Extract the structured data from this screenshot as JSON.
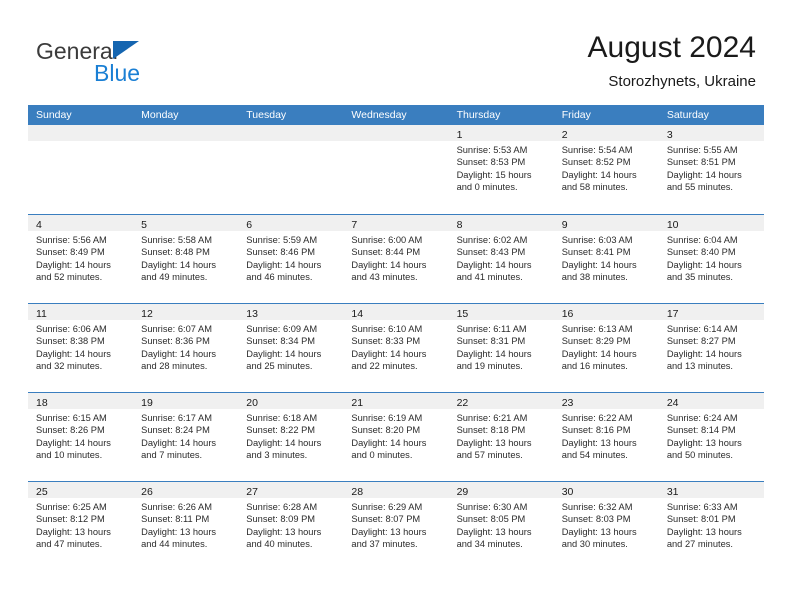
{
  "brand": {
    "name_dark": "General",
    "name_blue": "Blue",
    "triangle_icon": "triangle-icon",
    "accent_color": "#1a7fd4",
    "triangle_color": "#1565b0"
  },
  "header": {
    "title": "August 2024",
    "subtitle": "Storozhynets, Ukraine"
  },
  "colors": {
    "header_row_bg": "#3a7ebf",
    "day_band_bg": "#f0f0f0",
    "row_divider": "#3a7ebf",
    "text": "#1a1a1a"
  },
  "weekdays": [
    "Sunday",
    "Monday",
    "Tuesday",
    "Wednesday",
    "Thursday",
    "Friday",
    "Saturday"
  ],
  "weeks": [
    [
      {
        "day": "",
        "empty": true
      },
      {
        "day": "",
        "empty": true
      },
      {
        "day": "",
        "empty": true
      },
      {
        "day": "",
        "empty": true
      },
      {
        "day": "1",
        "sunrise": "Sunrise: 5:53 AM",
        "sunset": "Sunset: 8:53 PM",
        "daylight_1": "Daylight: 15 hours",
        "daylight_2": "and 0 minutes."
      },
      {
        "day": "2",
        "sunrise": "Sunrise: 5:54 AM",
        "sunset": "Sunset: 8:52 PM",
        "daylight_1": "Daylight: 14 hours",
        "daylight_2": "and 58 minutes."
      },
      {
        "day": "3",
        "sunrise": "Sunrise: 5:55 AM",
        "sunset": "Sunset: 8:51 PM",
        "daylight_1": "Daylight: 14 hours",
        "daylight_2": "and 55 minutes."
      }
    ],
    [
      {
        "day": "4",
        "sunrise": "Sunrise: 5:56 AM",
        "sunset": "Sunset: 8:49 PM",
        "daylight_1": "Daylight: 14 hours",
        "daylight_2": "and 52 minutes."
      },
      {
        "day": "5",
        "sunrise": "Sunrise: 5:58 AM",
        "sunset": "Sunset: 8:48 PM",
        "daylight_1": "Daylight: 14 hours",
        "daylight_2": "and 49 minutes."
      },
      {
        "day": "6",
        "sunrise": "Sunrise: 5:59 AM",
        "sunset": "Sunset: 8:46 PM",
        "daylight_1": "Daylight: 14 hours",
        "daylight_2": "and 46 minutes."
      },
      {
        "day": "7",
        "sunrise": "Sunrise: 6:00 AM",
        "sunset": "Sunset: 8:44 PM",
        "daylight_1": "Daylight: 14 hours",
        "daylight_2": "and 43 minutes."
      },
      {
        "day": "8",
        "sunrise": "Sunrise: 6:02 AM",
        "sunset": "Sunset: 8:43 PM",
        "daylight_1": "Daylight: 14 hours",
        "daylight_2": "and 41 minutes."
      },
      {
        "day": "9",
        "sunrise": "Sunrise: 6:03 AM",
        "sunset": "Sunset: 8:41 PM",
        "daylight_1": "Daylight: 14 hours",
        "daylight_2": "and 38 minutes."
      },
      {
        "day": "10",
        "sunrise": "Sunrise: 6:04 AM",
        "sunset": "Sunset: 8:40 PM",
        "daylight_1": "Daylight: 14 hours",
        "daylight_2": "and 35 minutes."
      }
    ],
    [
      {
        "day": "11",
        "sunrise": "Sunrise: 6:06 AM",
        "sunset": "Sunset: 8:38 PM",
        "daylight_1": "Daylight: 14 hours",
        "daylight_2": "and 32 minutes."
      },
      {
        "day": "12",
        "sunrise": "Sunrise: 6:07 AM",
        "sunset": "Sunset: 8:36 PM",
        "daylight_1": "Daylight: 14 hours",
        "daylight_2": "and 28 minutes."
      },
      {
        "day": "13",
        "sunrise": "Sunrise: 6:09 AM",
        "sunset": "Sunset: 8:34 PM",
        "daylight_1": "Daylight: 14 hours",
        "daylight_2": "and 25 minutes."
      },
      {
        "day": "14",
        "sunrise": "Sunrise: 6:10 AM",
        "sunset": "Sunset: 8:33 PM",
        "daylight_1": "Daylight: 14 hours",
        "daylight_2": "and 22 minutes."
      },
      {
        "day": "15",
        "sunrise": "Sunrise: 6:11 AM",
        "sunset": "Sunset: 8:31 PM",
        "daylight_1": "Daylight: 14 hours",
        "daylight_2": "and 19 minutes."
      },
      {
        "day": "16",
        "sunrise": "Sunrise: 6:13 AM",
        "sunset": "Sunset: 8:29 PM",
        "daylight_1": "Daylight: 14 hours",
        "daylight_2": "and 16 minutes."
      },
      {
        "day": "17",
        "sunrise": "Sunrise: 6:14 AM",
        "sunset": "Sunset: 8:27 PM",
        "daylight_1": "Daylight: 14 hours",
        "daylight_2": "and 13 minutes."
      }
    ],
    [
      {
        "day": "18",
        "sunrise": "Sunrise: 6:15 AM",
        "sunset": "Sunset: 8:26 PM",
        "daylight_1": "Daylight: 14 hours",
        "daylight_2": "and 10 minutes."
      },
      {
        "day": "19",
        "sunrise": "Sunrise: 6:17 AM",
        "sunset": "Sunset: 8:24 PM",
        "daylight_1": "Daylight: 14 hours",
        "daylight_2": "and 7 minutes."
      },
      {
        "day": "20",
        "sunrise": "Sunrise: 6:18 AM",
        "sunset": "Sunset: 8:22 PM",
        "daylight_1": "Daylight: 14 hours",
        "daylight_2": "and 3 minutes."
      },
      {
        "day": "21",
        "sunrise": "Sunrise: 6:19 AM",
        "sunset": "Sunset: 8:20 PM",
        "daylight_1": "Daylight: 14 hours",
        "daylight_2": "and 0 minutes."
      },
      {
        "day": "22",
        "sunrise": "Sunrise: 6:21 AM",
        "sunset": "Sunset: 8:18 PM",
        "daylight_1": "Daylight: 13 hours",
        "daylight_2": "and 57 minutes."
      },
      {
        "day": "23",
        "sunrise": "Sunrise: 6:22 AM",
        "sunset": "Sunset: 8:16 PM",
        "daylight_1": "Daylight: 13 hours",
        "daylight_2": "and 54 minutes."
      },
      {
        "day": "24",
        "sunrise": "Sunrise: 6:24 AM",
        "sunset": "Sunset: 8:14 PM",
        "daylight_1": "Daylight: 13 hours",
        "daylight_2": "and 50 minutes."
      }
    ],
    [
      {
        "day": "25",
        "sunrise": "Sunrise: 6:25 AM",
        "sunset": "Sunset: 8:12 PM",
        "daylight_1": "Daylight: 13 hours",
        "daylight_2": "and 47 minutes."
      },
      {
        "day": "26",
        "sunrise": "Sunrise: 6:26 AM",
        "sunset": "Sunset: 8:11 PM",
        "daylight_1": "Daylight: 13 hours",
        "daylight_2": "and 44 minutes."
      },
      {
        "day": "27",
        "sunrise": "Sunrise: 6:28 AM",
        "sunset": "Sunset: 8:09 PM",
        "daylight_1": "Daylight: 13 hours",
        "daylight_2": "and 40 minutes."
      },
      {
        "day": "28",
        "sunrise": "Sunrise: 6:29 AM",
        "sunset": "Sunset: 8:07 PM",
        "daylight_1": "Daylight: 13 hours",
        "daylight_2": "and 37 minutes."
      },
      {
        "day": "29",
        "sunrise": "Sunrise: 6:30 AM",
        "sunset": "Sunset: 8:05 PM",
        "daylight_1": "Daylight: 13 hours",
        "daylight_2": "and 34 minutes."
      },
      {
        "day": "30",
        "sunrise": "Sunrise: 6:32 AM",
        "sunset": "Sunset: 8:03 PM",
        "daylight_1": "Daylight: 13 hours",
        "daylight_2": "and 30 minutes."
      },
      {
        "day": "31",
        "sunrise": "Sunrise: 6:33 AM",
        "sunset": "Sunset: 8:01 PM",
        "daylight_1": "Daylight: 13 hours",
        "daylight_2": "and 27 minutes."
      }
    ]
  ]
}
